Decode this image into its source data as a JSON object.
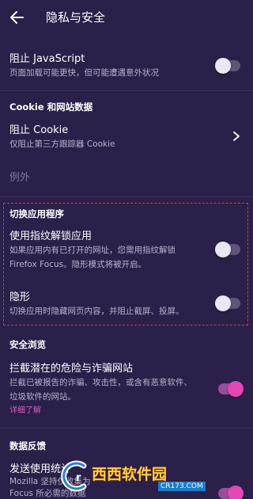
{
  "appbar": {
    "title": "隐私与安全"
  },
  "block_js": {
    "title": "阻止 JavaScript",
    "subtitle": "页面加载可能更快，但可能遭遇意外状况",
    "enabled": false
  },
  "cookie_section": {
    "header": "Cookie 和网站数据",
    "block_cookie_title": "阻止 Cookie",
    "block_cookie_subtitle": "仅阻止第三方跟踪器 Cookie",
    "exceptions_label": "例外"
  },
  "switch_app_section": {
    "header": "切换应用程序",
    "fingerprint_title": "使用指纹解锁应用",
    "fingerprint_subtitle_1": "如果应用内有已打开的网址，您需用指纹解锁",
    "fingerprint_subtitle_2": "Firefox Focus。隐形模式将被开启。",
    "fingerprint_enabled": false,
    "stealth_title": "隐形",
    "stealth_subtitle": "切换应用时隐藏网页内容，并阻止截屏、投屏。",
    "stealth_enabled": false
  },
  "safe_browsing_section": {
    "header": "安全浏览",
    "title": "拦截潜在的危险与诈骗网站",
    "subtitle_1": "拦截已被报告的诈骗、攻击性，或含有恶意软件、",
    "subtitle_2": "垃圾软件的网站。",
    "learn_more": "详细了解",
    "enabled": true
  },
  "data_section": {
    "header": "数据反馈",
    "title": "发送使用统计",
    "subtitle_1": "Mozilla 坚持仅收集为",
    "subtitle_2": "Focus 所必需的数据",
    "enabled": true
  },
  "watermark": {
    "brand": "西西软件园",
    "url": "CR173.COM"
  },
  "colors": {
    "background": "#2a2049",
    "accent": "#e247b5",
    "link": "#d65fc2",
    "highlight_border": "#d93a4e"
  }
}
